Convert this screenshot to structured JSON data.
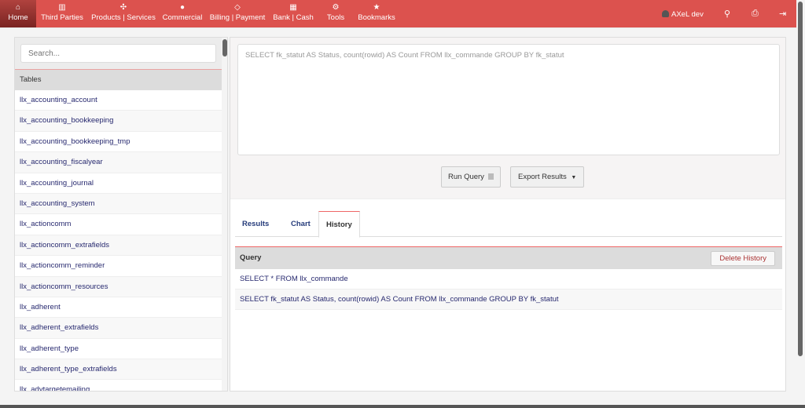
{
  "nav": {
    "items": [
      {
        "label": "Home",
        "icon": "home-icon",
        "glyph": "⌂"
      },
      {
        "label": "Third Parties",
        "icon": "building-icon",
        "glyph": "▥"
      },
      {
        "label": "Products | Services",
        "icon": "cubes-icon",
        "glyph": "✣"
      },
      {
        "label": "Commercial",
        "icon": "user-icon",
        "glyph": "●"
      },
      {
        "label": "Billing | Payment",
        "icon": "diamond-icon",
        "glyph": "◇"
      },
      {
        "label": "Bank | Cash",
        "icon": "bank-icon",
        "glyph": "▦"
      },
      {
        "label": "Tools",
        "icon": "cogs-icon",
        "glyph": "⚙"
      },
      {
        "label": "Bookmarks",
        "icon": "star-icon",
        "glyph": "★"
      }
    ],
    "user": "AXeL dev",
    "search_glyph": "⚲",
    "print_glyph": "⎙",
    "logout_glyph": "⇥"
  },
  "sidebar": {
    "search_placeholder": "Search...",
    "tables_header": "Tables",
    "tables": [
      "llx_accounting_account",
      "llx_accounting_bookkeeping",
      "llx_accounting_bookkeeping_tmp",
      "llx_accounting_fiscalyear",
      "llx_accounting_journal",
      "llx_accounting_system",
      "llx_actioncomm",
      "llx_actioncomm_extrafields",
      "llx_actioncomm_reminder",
      "llx_actioncomm_resources",
      "llx_adherent",
      "llx_adherent_extrafields",
      "llx_adherent_type",
      "llx_adherent_type_extrafields",
      "llx_advtargetemailing"
    ]
  },
  "query": {
    "text": "SELECT fk_statut AS Status, count(rowid) AS Count FROM llx_commande GROUP BY fk_statut",
    "run_label": "Run Query",
    "export_label": "Export Results"
  },
  "tabs": [
    "Results",
    "Chart",
    "History"
  ],
  "history": {
    "header": "Query",
    "delete_label": "Delete History",
    "rows": [
      "SELECT * FROM llx_commande",
      "SELECT fk_statut AS Status, count(rowid) AS Count FROM llx_commande GROUP BY fk_statut"
    ]
  }
}
